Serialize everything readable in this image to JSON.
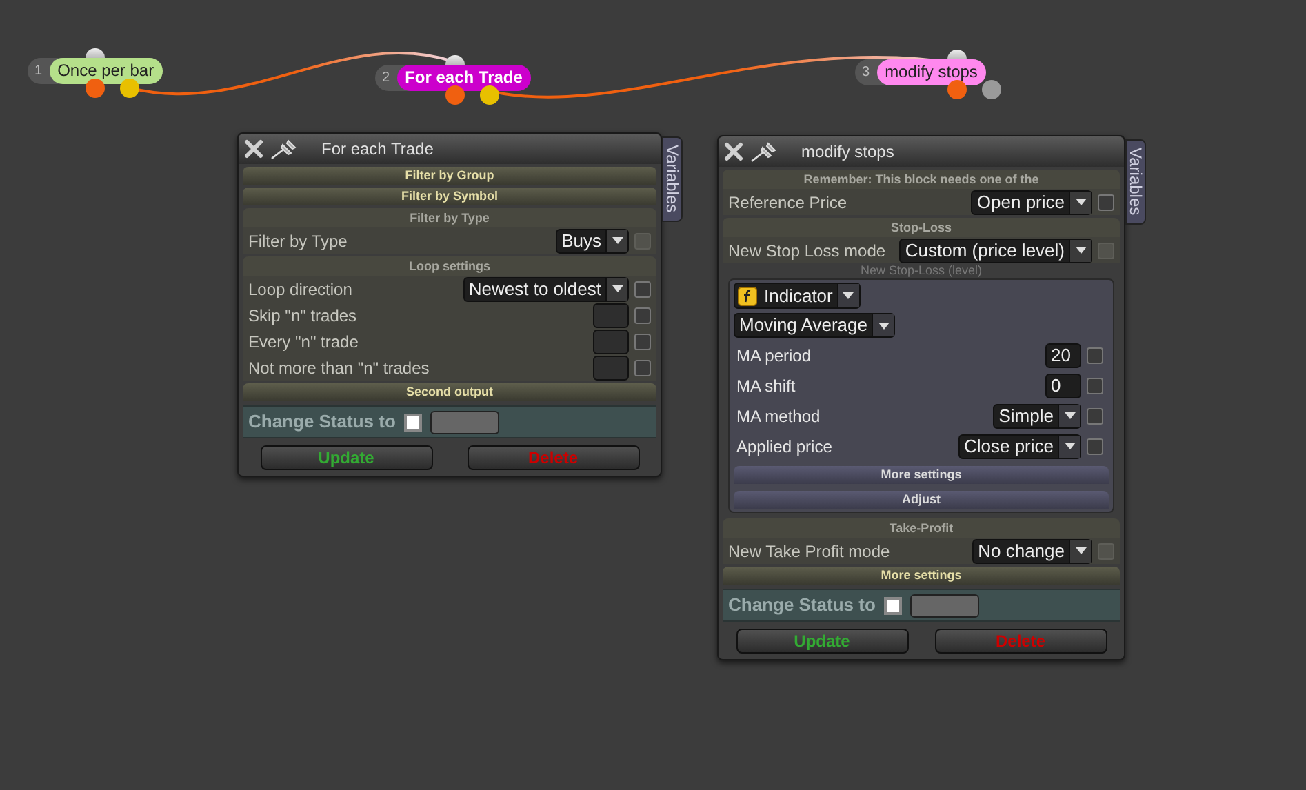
{
  "nodes": [
    {
      "number": "1",
      "label": "Once per bar",
      "color": "#b5e08a",
      "selected": false,
      "outputs": [
        {
          "color": "#f06010"
        },
        {
          "color": "#e8c000"
        }
      ]
    },
    {
      "number": "2",
      "label": "For each Trade",
      "color": "#cc00cc",
      "selected": true,
      "outputs": [
        {
          "color": "#f06010"
        },
        {
          "color": "#e8c000"
        }
      ]
    },
    {
      "number": "3",
      "label": "modify stops",
      "color": "#ff88ee",
      "selected": false,
      "outputs": [
        {
          "color": "#f06010"
        },
        {
          "color": "#9a9a9a"
        }
      ]
    }
  ],
  "panels": [
    {
      "title": "For each Trade",
      "side_tab": "Variables",
      "rows": [
        {
          "kind": "bar",
          "label": "Filter by Group"
        },
        {
          "kind": "bar",
          "label": "Filter by Symbol"
        },
        {
          "kind": "group",
          "title": "Filter by Type",
          "rows": [
            {
              "kind": "select",
              "label": "Filter by Type",
              "value": "Buys",
              "checkbox_disabled": true
            }
          ]
        },
        {
          "kind": "group",
          "title": "Loop settings",
          "rows": [
            {
              "kind": "select",
              "label": "Loop direction",
              "value": "Newest to oldest",
              "checkbox_disabled": false
            },
            {
              "kind": "input",
              "label": "Skip \"n\" trades",
              "checkbox_disabled": false
            },
            {
              "kind": "input",
              "label": "Every \"n\" trade",
              "checkbox_disabled": false
            },
            {
              "kind": "input",
              "label": "Not more than \"n\" trades",
              "checkbox_disabled": false
            }
          ]
        },
        {
          "kind": "bar",
          "label": "Second output"
        }
      ],
      "status": {
        "label": "Change Status to",
        "checked": false
      },
      "buttons": [
        {
          "label": "Update",
          "kind": "confirm"
        },
        {
          "label": "Delete",
          "kind": "danger"
        }
      ]
    },
    {
      "title": "modify stops",
      "side_tab": "Variables",
      "rows": [
        {
          "kind": "group",
          "title": "Remember: This block needs one of the",
          "rows": [
            {
              "kind": "select",
              "label": "Reference Price",
              "value": "Open price",
              "checkbox_disabled": false
            }
          ]
        },
        {
          "kind": "group",
          "title": "Stop-Loss",
          "rows": [
            {
              "kind": "select",
              "label": "New Stop Loss mode",
              "value": "Custom (price level)",
              "checkbox_disabled": true
            },
            {
              "kind": "caption",
              "label": "New Stop-Loss (level)"
            },
            {
              "kind": "subpanel",
              "rows": [
                {
                  "kind": "func_select",
                  "value": "Indicator"
                },
                {
                  "kind": "plain_select",
                  "value": "Moving Average"
                },
                {
                  "kind": "input",
                  "label": "MA period",
                  "value": "20",
                  "checkbox_disabled": false
                },
                {
                  "kind": "input",
                  "label": "MA shift",
                  "value": "0",
                  "checkbox_disabled": false
                },
                {
                  "kind": "select",
                  "label": "MA method",
                  "value": "Simple",
                  "checkbox_disabled": false
                },
                {
                  "kind": "select",
                  "label": "Applied price",
                  "value": "Close price",
                  "checkbox_disabled": false
                },
                {
                  "kind": "bar",
                  "label": "More settings"
                },
                {
                  "kind": "bar",
                  "label": "Adjust"
                }
              ]
            }
          ]
        },
        {
          "kind": "group",
          "title": "Take-Profit",
          "rows": [
            {
              "kind": "select",
              "label": "New Take Profit mode",
              "value": "No change",
              "checkbox_disabled": true
            }
          ]
        },
        {
          "kind": "bar",
          "label": "More settings"
        }
      ],
      "status": {
        "label": "Change Status to",
        "checked": false
      },
      "buttons": [
        {
          "label": "Update",
          "kind": "confirm"
        },
        {
          "label": "Delete",
          "kind": "danger"
        }
      ]
    }
  ]
}
